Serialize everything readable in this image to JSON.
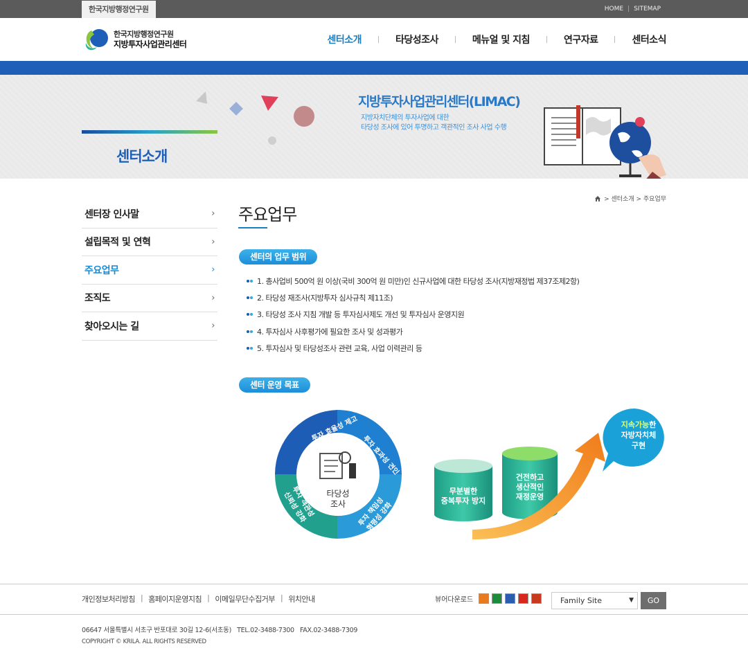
{
  "topbar": {
    "org_tab": "한국지방행정연구원",
    "home": "HOME",
    "sep": "|",
    "sitemap": "SITEMAP"
  },
  "logo": {
    "line1": "한국지방행정연구원",
    "line2": "지방투자사업관리센터"
  },
  "gnb": [
    {
      "label": "센터소개"
    },
    {
      "label": "타당성조사"
    },
    {
      "label": "메뉴얼 및 지침"
    },
    {
      "label": "연구자료"
    },
    {
      "label": "센터소식"
    }
  ],
  "visual": {
    "section_title": "센터소개",
    "headline": "지방투자사업관리센터(LIMAC)",
    "desc1": "지방자치단체의 투자사업에 대한",
    "desc2": "타당성 조사에 있어 투명하고 객관적인 조사 사업 수행"
  },
  "lnb": [
    {
      "label": "센터장 인사말"
    },
    {
      "label": "설립목적 및 연혁"
    },
    {
      "label": "주요업무"
    },
    {
      "label": "조직도"
    },
    {
      "label": "찾아오시는 길"
    }
  ],
  "breadcrumb": {
    "path": "> 센터소개 > 주요업무"
  },
  "page_title": "주요업무",
  "scope": {
    "label": "센터의 업무 범위",
    "items": [
      "1. 총사업비 500억 원 이상(국비 300억 원 미만)인 신규사업에 대한 타당성 조사(지방재정법 제37조제2항)",
      "2. 타당성 재조사(지방투자 심사규칙 제11조)",
      "3. 타당성 조사 지침 개발 등 투자심사제도 개선 및 투자심사 운영지원",
      "4. 투자심사 사후평가에 필요한 조사 및 성과평가",
      "5. 투자심사 및 타당성조사 관련 교육, 사업 이력관리 등"
    ]
  },
  "goals": {
    "label": "센터 운영 목표",
    "seg_top": "투자 효율성 제고",
    "seg_right_top": "투자 효과성 견인",
    "seg_right_bottom1": "투자 책임성",
    "seg_right_bottom2": "형평성 강화",
    "seg_left1": "투자 객관성",
    "seg_left2": "신뢰성 강화",
    "center1": "타당성",
    "center2": "조사",
    "cyl1_1": "무분별한",
    "cyl1_2": "중복투자 방지",
    "cyl2_1": "건전하고",
    "cyl2_2": "생산적인",
    "cyl2_3": "재정운영",
    "bubble_hl": "지속가능",
    "bubble_hl_suffix": "한",
    "bubble2": "자방자치체",
    "bubble3": "구현"
  },
  "footer": {
    "links": [
      "개인정보처리방침",
      "홈페이지운영지침",
      "이메일무단수집거부",
      "위치안내"
    ],
    "viewer_label": "뷰어다운로드",
    "family": "Family Site",
    "go": "GO",
    "address": "06647 서울특별시 서초구 반포대로 30길 12-6(서초동)   TEL.02-3488-7300   FAX.02-3488-7309",
    "copyright": "COPYRIGHT © KRILA. ALL RIGHTS RESERVED"
  },
  "colors": {
    "accent": "#1e5fb8",
    "active": "#1a8ad4",
    "green": "#2bb79c",
    "orange": "#f58c1e"
  }
}
